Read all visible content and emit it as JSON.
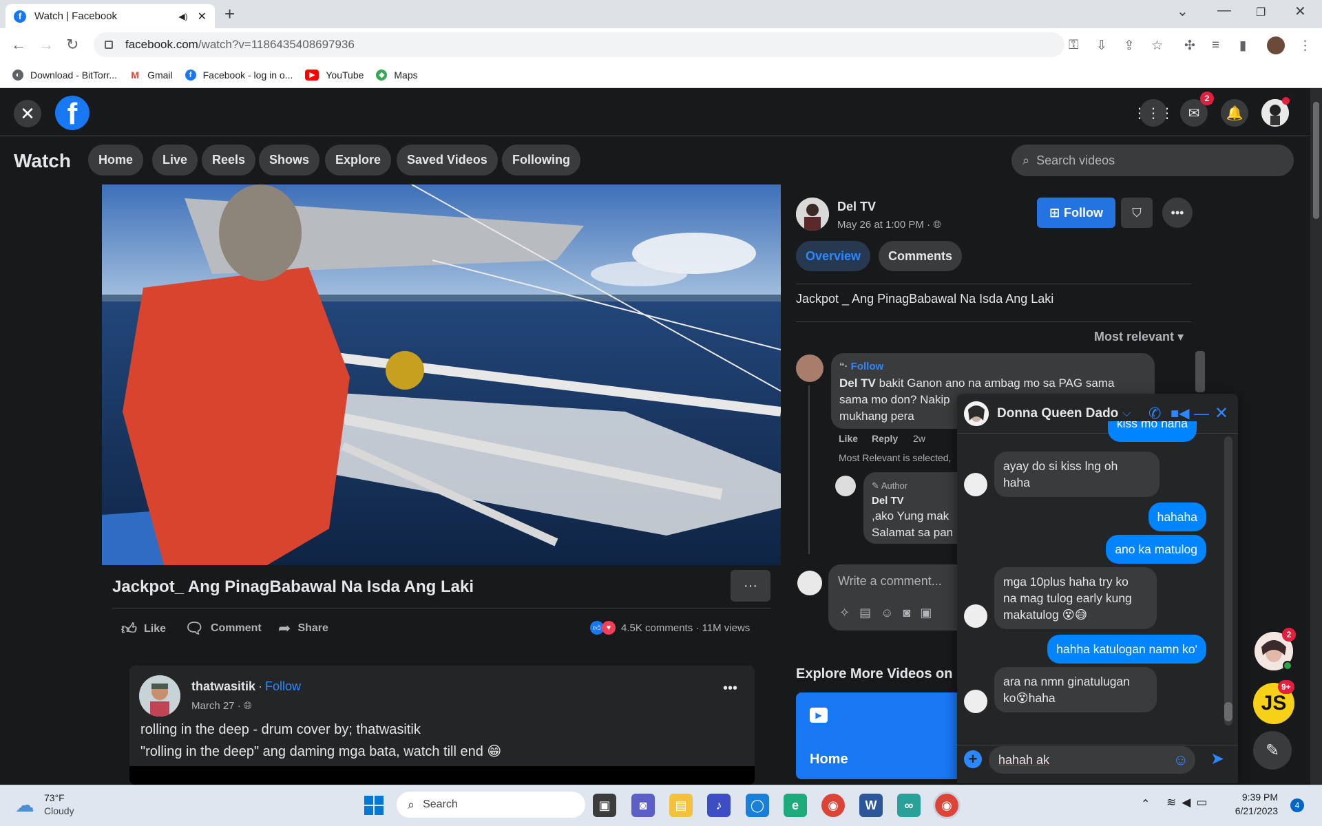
{
  "browser": {
    "tab_title": "Watch | Facebook",
    "url_domain": "facebook.com",
    "url_path": "/watch?v=1186435408697936",
    "bookmarks": [
      {
        "label": "Download - BitTorr...",
        "color": "#5f6368"
      },
      {
        "label": "Gmail",
        "color": "#ea4335"
      },
      {
        "label": "Facebook - log in o...",
        "color": "#1877f2"
      },
      {
        "label": "YouTube",
        "color": "#ff0000"
      },
      {
        "label": "Maps",
        "color": "#34a853"
      }
    ]
  },
  "header": {
    "messenger_badge": "2",
    "section_title": "Watch",
    "nav": [
      "Home",
      "Live",
      "Reels",
      "Shows",
      "Explore",
      "Saved Videos",
      "Following"
    ],
    "search_placeholder": "Search videos"
  },
  "video": {
    "title": "Jackpot_ Ang PinagBabawal Na Isda Ang Laki",
    "actions": {
      "like": "Like",
      "comment": "Comment",
      "share": "Share"
    },
    "stats": "4.5K comments · 11M views",
    "more": "···"
  },
  "post": {
    "page_name": "Del TV",
    "date": "May 26 at 1:00 PM ·",
    "follow_label": "Follow",
    "tabs": {
      "overview": "Overview",
      "comments": "Comments"
    },
    "description": "Jackpot _ Ang PinagBabawal Na Isda Ang Laki",
    "sort_label": "Most relevant"
  },
  "comments": [
    {
      "badge": "Follow",
      "author": "Del TV",
      "text_line1": "bakit Ganon ano na ambag mo sa PAG sama",
      "text_line2": "sama mo don? Nakip",
      "text_line3": "mukhang pera",
      "like": "Like",
      "reply": "Reply",
      "time": "2w",
      "note": "Most Relevant is selected,"
    },
    {
      "badge": "Author",
      "author": "Del TV",
      "text_line1": ",ako Yung mak",
      "text_line2": "Salamat sa pan"
    }
  ],
  "comment_box": {
    "placeholder": "Write a comment..."
  },
  "explore": {
    "heading": "Explore More Videos on",
    "tile_label": "Home"
  },
  "feed_post": {
    "author": "thatwasitik",
    "follow": "Follow",
    "date": "March 27 ·",
    "title": "rolling in the deep - drum cover by; thatwasitik",
    "caption": "\"rolling in the deep\" ang daming mga bata, watch till end 😁"
  },
  "chat": {
    "contact": "Donna Queen Dado",
    "messages_top_cut": "kiss mo haha",
    "messages": [
      {
        "dir": "in",
        "text_line1": "ayay do si kiss lng oh",
        "text_line2": "haha"
      },
      {
        "dir": "out",
        "text": "hahaha"
      },
      {
        "dir": "out",
        "text": "ano ka matulog"
      },
      {
        "dir": "in",
        "text_line1": "mga 10plus haha try ko",
        "text_line2": "na mag tulog early kung",
        "text_line3": "makatulog 😵😅"
      },
      {
        "dir": "out",
        "text": "hahha katulogan namn ko'"
      },
      {
        "dir": "in",
        "text_line1": "ara na nmn ginatulugan",
        "text_line2": "ko😵haha"
      }
    ],
    "input_value": "hahah ak"
  },
  "side_bubbles": {
    "badge1": "2",
    "badge2": "9+",
    "initials": "JS"
  },
  "taskbar": {
    "weather_temp": "73°F",
    "weather_desc": "Cloudy",
    "search_label": "Search",
    "time": "9:39 PM",
    "date": "6/21/2023",
    "notif_count": "4"
  }
}
